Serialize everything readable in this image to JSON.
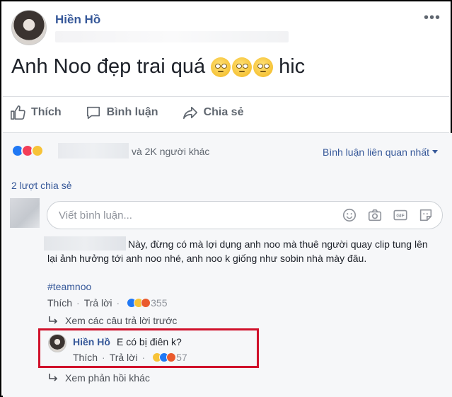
{
  "post": {
    "author": "Hiền Hồ",
    "text": "Anh Noo đẹp trai quá",
    "text_suffix": "hic",
    "emoji_icons": [
      "face-rolling-eyes-icon",
      "face-rolling-eyes-icon",
      "face-rolling-eyes-icon"
    ],
    "more_glyph": "•••"
  },
  "actions": {
    "like": "Thích",
    "comment": "Bình luận",
    "share": "Chia sẻ"
  },
  "reactions": {
    "icons": [
      "like-icon",
      "love-icon",
      "haha-icon"
    ],
    "summary": "và 2K người khác",
    "sort_label": "Bình luận liên quan nhất"
  },
  "shares_text": "2 lượt chia sẻ",
  "comment_input": {
    "placeholder": "Viết bình luận...",
    "icons": [
      "emoji-icon",
      "camera-icon",
      "gif-icon",
      "sticker-icon"
    ]
  },
  "comments": [
    {
      "text": "Này, đừng có mà lợi dụng anh noo mà thuê người quay clip tung lên lại ảnh hưởng tới anh noo nhé, anh noo k giống như sobin nhà mày đâu.",
      "hashtag": "#teamnoo",
      "like_label": "Thích",
      "reply_label": "Trả lời",
      "reaction_count": "355",
      "view_previous": "Xem các câu trả lời trước",
      "reply": {
        "author": "Hiền Hồ",
        "text": "E có bị điên k?",
        "like_label": "Thích",
        "reply_label": "Trả lời",
        "reaction_count": "57"
      },
      "view_more": "Xem phản hồi khác"
    }
  ],
  "colors": {
    "link_blue": "#365899",
    "highlight_red": "#d0112b",
    "muted_gray": "#606770"
  }
}
